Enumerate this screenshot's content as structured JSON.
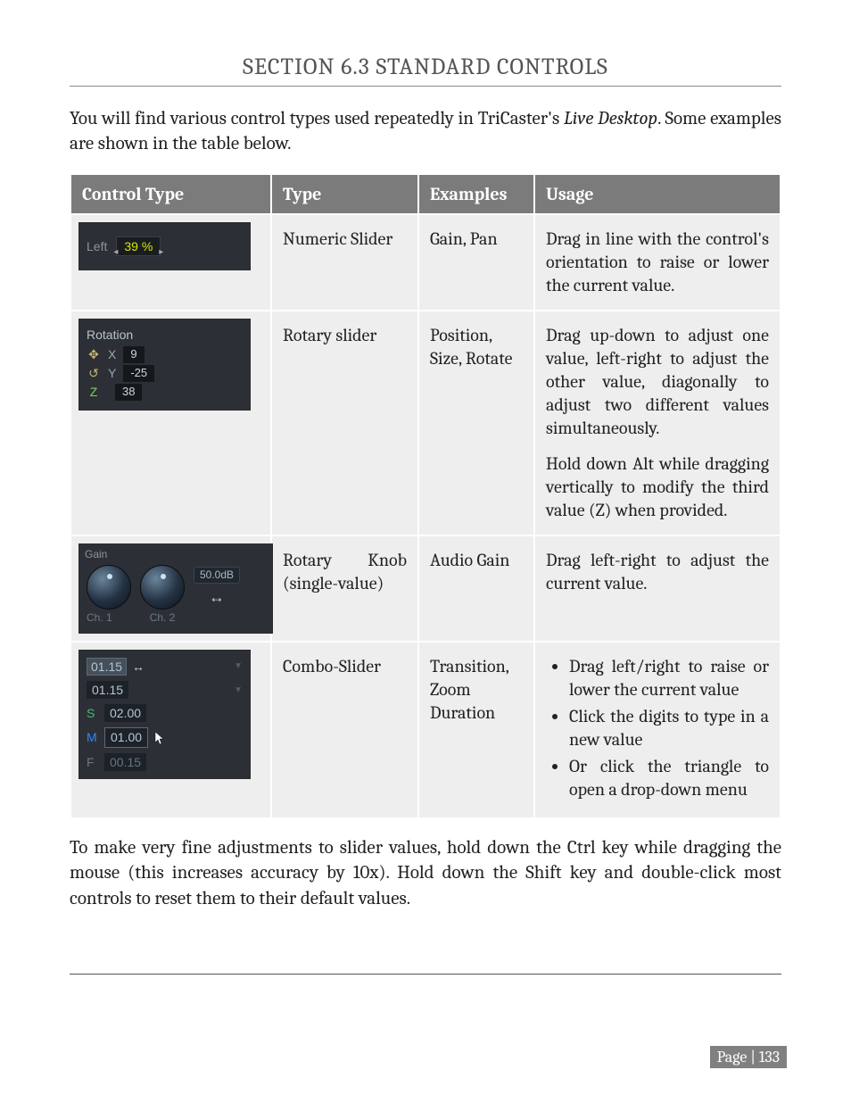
{
  "section_title": "SECTION 6.3 STANDARD CONTROLS",
  "intro_pre": "You will find various control types used repeatedly in TriCaster's ",
  "intro_italic": "Live Desktop",
  "intro_post": ". Some examples are shown in the table below.",
  "headers": {
    "control_type": "Control Type",
    "type": "Type",
    "examples": "Examples",
    "usage": "Usage"
  },
  "rows": {
    "r1": {
      "type": "Numeric Slider",
      "examples": "Gain, Pan",
      "usage": "Drag in line with the control's orientation to raise or lower the current value.",
      "img": {
        "label": "Left",
        "value": "39 %"
      }
    },
    "r2": {
      "type": "Rotary slider",
      "examples": "Position, Size, Rotate",
      "usage_p1": "Drag up-down to adjust one value, left-right to adjust the other value, diagonally to adjust two different values simultaneously.",
      "usage_p2": "Hold down Alt while dragging vertically to modify the third value (Z) when provided.",
      "img": {
        "title": "Rotation",
        "x": "9",
        "y": "-25",
        "z": "38"
      }
    },
    "r3": {
      "type": "Rotary Knob (single-value)",
      "examples": "Audio Gain",
      "usage": "Drag left-right to adjust the current value.",
      "img": {
        "label": "Gain",
        "badge": "50.0dB",
        "ch1": "Ch. 1",
        "ch2": "Ch. 2",
        "arrows": "↔"
      }
    },
    "r4": {
      "type": "Combo-Slider",
      "examples": "Transition, Zoom Duration",
      "usage_items": [
        "Drag left/right to raise or lower the current value",
        "Click the digits to type in a new value",
        "Or click the triangle to open a drop-down menu"
      ],
      "img": {
        "hover": "01.15",
        "sel": "01.15",
        "s": "02.00",
        "m": "01.00",
        "f": "00.15"
      }
    }
  },
  "outro_pre": "To make very fine adjustments to slider values, hold down the Ctrl key while dragging the mouse (this increases accuracy by 10x). Hold down the ",
  "outro_italic": "Shift",
  "outro_post": " key and double-click most controls to reset them to their default values.",
  "page_label": "Page | 133"
}
